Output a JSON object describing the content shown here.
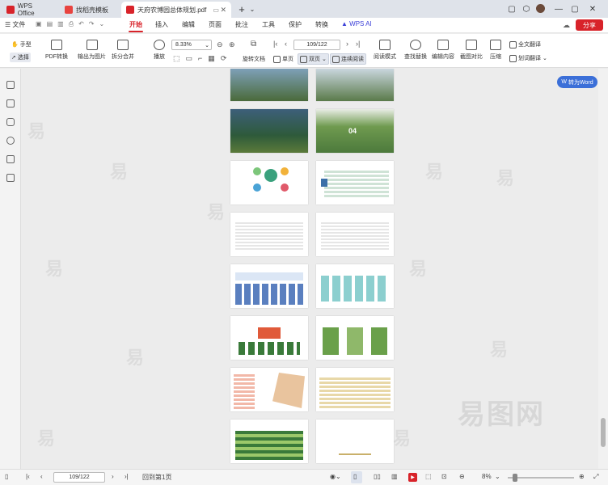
{
  "tabs": [
    {
      "label": "WPS Office",
      "color": "#d8232a"
    },
    {
      "label": "找稻壳模板",
      "color": "#e8433f"
    },
    {
      "label": "天府农博园总体规划.pdf",
      "color": "#d8232a"
    }
  ],
  "menu": {
    "file": "文件",
    "items": [
      "开始",
      "插入",
      "编辑",
      "页面",
      "批注",
      "工具",
      "保护",
      "转换",
      "WPS AI"
    ],
    "share": "分享"
  },
  "ribbon": {
    "hand": "手型",
    "select": "选择",
    "pdf_convert": "PDF转换",
    "export_image": "输出为图片",
    "split_merge": "拆分合并",
    "play": "播放",
    "zoom": "8.33%",
    "page": "109/122",
    "rotate": "旋转文档",
    "single": "单页",
    "double": "双页",
    "continuous": "连续阅读",
    "read_mode": "阅读模式",
    "find_replace": "查找替换",
    "edit_content": "编辑内容",
    "screenshot_compare": "截图对比",
    "compress": "压缩",
    "full_translate": "全文翻译",
    "word_translate": "划词翻译"
  },
  "doc": {
    "to_word": "转为Word",
    "watermark": "易"
  },
  "status": {
    "page": "109/122",
    "back": "回到第1页",
    "zoom": "8%"
  },
  "colors": {
    "accent": "#d8232a",
    "blue": "#3b6fd8",
    "green": "#3a7a3a"
  }
}
